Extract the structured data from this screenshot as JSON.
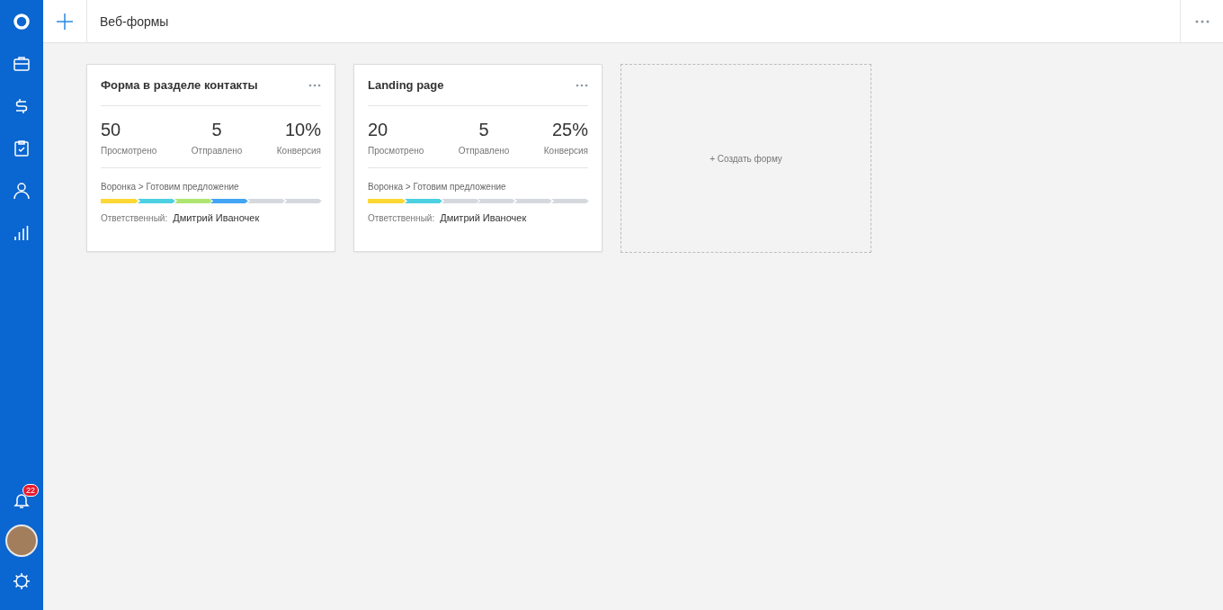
{
  "header": {
    "title": "Веб-формы"
  },
  "sidebar": {
    "badge": "22"
  },
  "forms": [
    {
      "title": "Форма в разделе контакты",
      "stats": [
        {
          "value": "50",
          "label": "Просмотрено"
        },
        {
          "value": "5",
          "label": "Отправлено"
        },
        {
          "value": "10%",
          "label": "Конверсия"
        }
      ],
      "funnel": "Воронка > Готовим предложение",
      "stages": [
        {
          "color": "#fdd835"
        },
        {
          "color": "#4dd0e1"
        },
        {
          "color": "#aee571"
        },
        {
          "color": "#42a5f5"
        },
        {
          "color": "#d5d9de"
        },
        {
          "color": "#d5d9de"
        }
      ],
      "owner_label": "Ответственный:",
      "owner": "Дмитрий Иваночек"
    },
    {
      "title": "Landing page",
      "stats": [
        {
          "value": "20",
          "label": "Просмотрено"
        },
        {
          "value": "5",
          "label": "Отправлено"
        },
        {
          "value": "25%",
          "label": "Конверсия"
        }
      ],
      "funnel": "Воронка > Готовим предложение",
      "stages": [
        {
          "color": "#fdd835"
        },
        {
          "color": "#4dd0e1"
        },
        {
          "color": "#d5d9de"
        },
        {
          "color": "#d5d9de"
        },
        {
          "color": "#d5d9de"
        },
        {
          "color": "#d5d9de"
        }
      ],
      "owner_label": "Ответственный:",
      "owner": "Дмитрий Иваночек"
    }
  ],
  "create_label": "+ Создать форму"
}
